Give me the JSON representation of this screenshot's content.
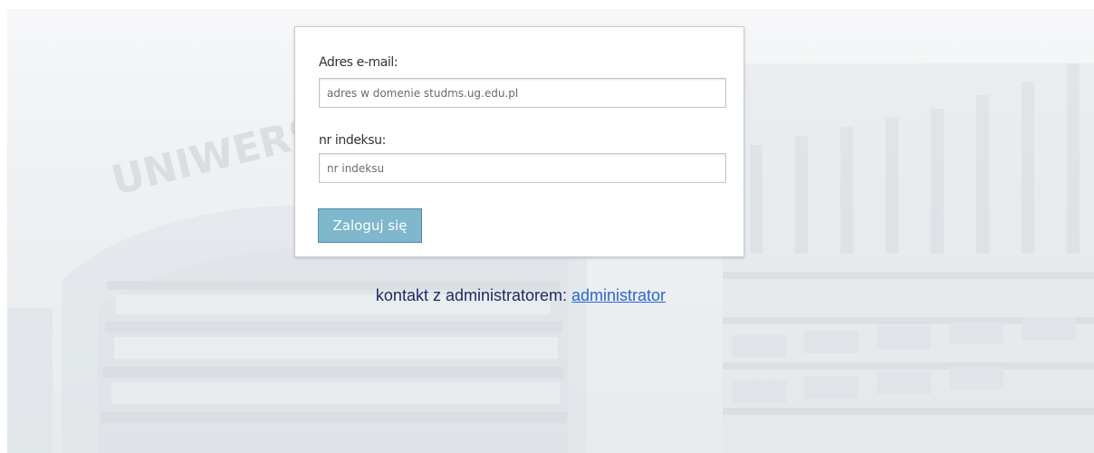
{
  "login_form": {
    "email_label": "Adres e-mail:",
    "email_placeholder": "adres w domenie studms.ug.edu.pl",
    "email_value": "",
    "index_label": "nr indeksu:",
    "index_placeholder": "nr indeksu",
    "index_value": "",
    "submit_label": "Zaloguj się"
  },
  "contact": {
    "prefix": "kontakt z administratorem:",
    "link_text": "administrator"
  },
  "background": {
    "sign_text": "UNIWERSYTET"
  },
  "colors": {
    "button_bg": "#7fb7cc",
    "link": "#2a66d6",
    "contact_text": "#1f2a66"
  }
}
